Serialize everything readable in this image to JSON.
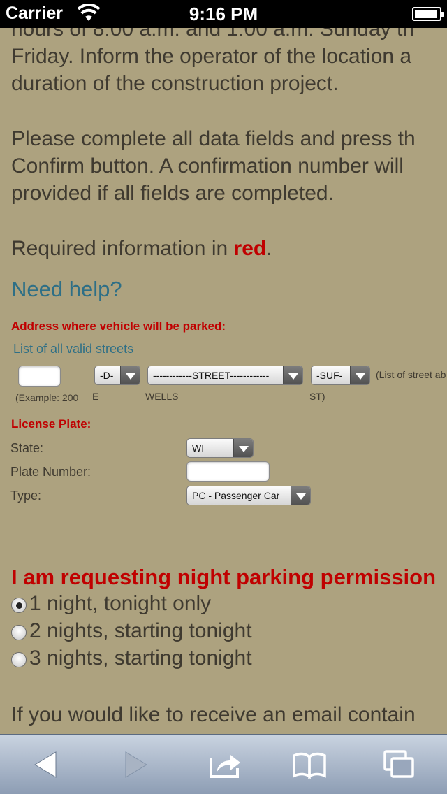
{
  "status_bar": {
    "carrier": "Carrier",
    "time": "9:16 PM"
  },
  "intro": {
    "lines": [
      "hours of 8:00 a.m. and 1:00 a.m. Sunday th",
      "Friday. Inform the operator of the location a",
      "duration of the construction project.",
      "Please complete all data fields and press th",
      "Confirm button. A confirmation number will",
      "provided if all fields are completed."
    ],
    "required_prefix": "Required information in ",
    "required_word": "red",
    "required_suffix": "."
  },
  "help_link": "Need help?",
  "address": {
    "heading": "Address where vehicle will be parked:",
    "valid_streets_link": "List of all valid streets",
    "number_value": "",
    "direction_select": "-D-",
    "street_select": "------------STREET------------",
    "suffix_select": "-SUF-",
    "street_note": "(List of street ab",
    "example_parts": [
      "(Example: 200",
      "E",
      "WELLS",
      "ST)"
    ]
  },
  "license": {
    "heading": "License Plate:",
    "state_label": "State:",
    "state_value": "WI",
    "plate_label": "Plate Number:",
    "plate_value": "",
    "type_label": "Type:",
    "type_value": "PC - Passenger Car"
  },
  "night_request": {
    "heading": "I am requesting night parking permission",
    "options": [
      {
        "label": "1 night, tonight only",
        "selected": true
      },
      {
        "label": "2 nights, starting tonight",
        "selected": false
      },
      {
        "label": "3 nights, starting tonight",
        "selected": false
      }
    ]
  },
  "email_text": "If you would like to receive an email contain",
  "toolbar_icons": [
    "back-icon",
    "forward-icon",
    "share-icon",
    "bookmarks-icon",
    "tabs-icon"
  ],
  "colors": {
    "background": "#ada27f",
    "required": "#c00000",
    "link": "#2e6f86"
  }
}
